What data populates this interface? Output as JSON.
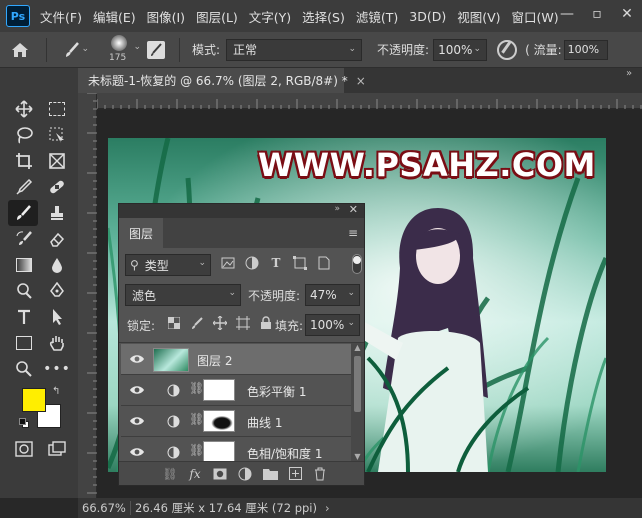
{
  "menubar": {
    "logo": "Ps",
    "items": [
      "文件(F)",
      "编辑(E)",
      "图像(I)",
      "图层(L)",
      "文字(Y)",
      "选择(S)",
      "滤镜(T)",
      "3D(D)",
      "视图(V)",
      "窗口(W)"
    ],
    "controls": [
      "—",
      "▫",
      "✕"
    ]
  },
  "options": {
    "brush_size": "175",
    "mode_label": "模式:",
    "mode_value": "正常",
    "opacity_label": "不透明度:",
    "opacity_value": "100%",
    "flow_label": "流量:",
    "flow_value": "100%"
  },
  "document_tab": {
    "title": "未标题-1-恢复的 @ 66.7% (图层 2, RGB/8#) *",
    "close": "×"
  },
  "canvas": {
    "watermark": "WWW.PSAHZ.COM",
    "colors": {
      "grass_dark": "#0f5a3a",
      "grass_light": "#8fe0c0",
      "sky": "#dff3ef"
    }
  },
  "layers_panel": {
    "tab_label": "图层",
    "filter_label": "类型",
    "blend_mode": "滤色",
    "opacity_label": "不透明度:",
    "opacity_value": "47%",
    "lock_label": "锁定:",
    "fill_label": "填充:",
    "fill_value": "100%",
    "layers": [
      {
        "name": "图层 2",
        "selected": true
      },
      {
        "name": "色彩平衡 1",
        "selected": false
      },
      {
        "name": "曲线 1",
        "selected": false
      },
      {
        "name": "色相/饱和度 1",
        "selected": false
      }
    ],
    "bottom_icons": [
      "link-icon",
      "fx-icon",
      "mask-icon",
      "adjustment-icon",
      "group-icon",
      "new-layer-icon",
      "trash-icon"
    ],
    "fx_label": "fx"
  },
  "colors": {
    "foreground": "#ffee00",
    "background": "#ffffff"
  },
  "status": {
    "zoom": "66.67%",
    "doc_info": "26.46 厘米 x 17.64 厘米 (72 ppi)",
    "more": "›"
  }
}
